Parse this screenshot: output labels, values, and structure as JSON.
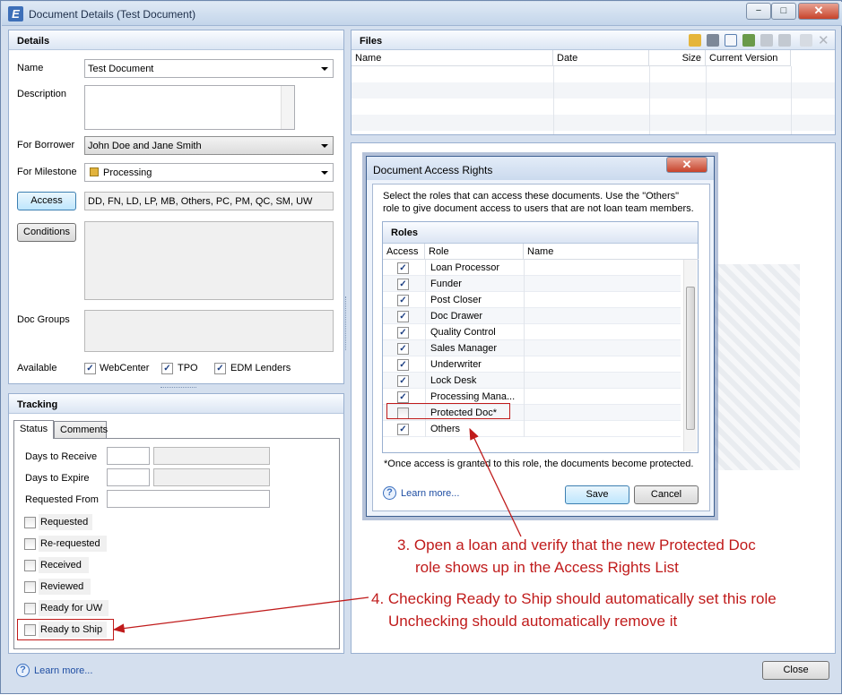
{
  "window": {
    "title": "Document Details (Test Document)",
    "app_icon": "E",
    "min": "−",
    "max": "□",
    "close": "✕"
  },
  "details": {
    "header": "Details",
    "name_label": "Name",
    "name_value": "Test Document",
    "description_label": "Description",
    "borrower_label": "For Borrower",
    "borrower_value": "John Doe and Jane Smith",
    "milestone_label": "For Milestone",
    "milestone_value": "Processing",
    "access_button": "Access",
    "access_value": "DD, FN, LD, LP, MB, Others, PC, PM, QC, SM, UW",
    "conditions_button": "Conditions",
    "docgroups_label": "Doc Groups",
    "available_label": "Available",
    "webcenter": "WebCenter",
    "tpo": "TPO",
    "edm": "EDM Lenders"
  },
  "tracking": {
    "header": "Tracking",
    "tab_status": "Status",
    "tab_comments": "Comments",
    "days_receive": "Days to Receive",
    "days_expire": "Days to Expire",
    "requested_from": "Requested From",
    "checks": [
      "Requested",
      "Re-requested",
      "Received",
      "Reviewed",
      "Ready for UW",
      "Ready to Ship"
    ]
  },
  "files": {
    "header": "Files",
    "columns": [
      "Name",
      "Date",
      "Size",
      "Current Version"
    ]
  },
  "dialog": {
    "title": "Document Access Rights",
    "close": "✕",
    "instructions_1": "Select the roles that can access these documents. Use the \"Others\"",
    "instructions_2": "role to give document access to users that are not loan team members.",
    "roles_header": "Roles",
    "col_access": "Access",
    "col_role": "Role",
    "col_name": "Name",
    "roles": [
      {
        "role": "Loan Processor",
        "checked": true
      },
      {
        "role": "Funder",
        "checked": true
      },
      {
        "role": "Post Closer",
        "checked": true
      },
      {
        "role": "Doc Drawer",
        "checked": true
      },
      {
        "role": "Quality Control",
        "checked": true
      },
      {
        "role": "Sales Manager",
        "checked": true
      },
      {
        "role": "Underwriter",
        "checked": true
      },
      {
        "role": "Lock Desk",
        "checked": true
      },
      {
        "role": "Processing Mana...",
        "checked": true
      },
      {
        "role": "Protected Doc*",
        "checked": false
      },
      {
        "role": "Others",
        "checked": true
      }
    ],
    "footnote": "*Once access is granted to this role, the documents become protected.",
    "learn_more": "Learn more...",
    "save": "Save",
    "cancel": "Cancel"
  },
  "annotations": {
    "a3_line1": "3. Open a loan and verify that the new Protected Doc",
    "a3_line2": "role shows up in the Access Rights List",
    "a4_line1": "4. Checking Ready to Ship should automatically set this role",
    "a4_line2": "Unchecking should automatically remove it"
  },
  "footer": {
    "learn_more": "Learn more...",
    "close": "Close"
  },
  "colors": {
    "annotation": "#c01b1b",
    "milestone_swatch": "#e2b33c"
  }
}
